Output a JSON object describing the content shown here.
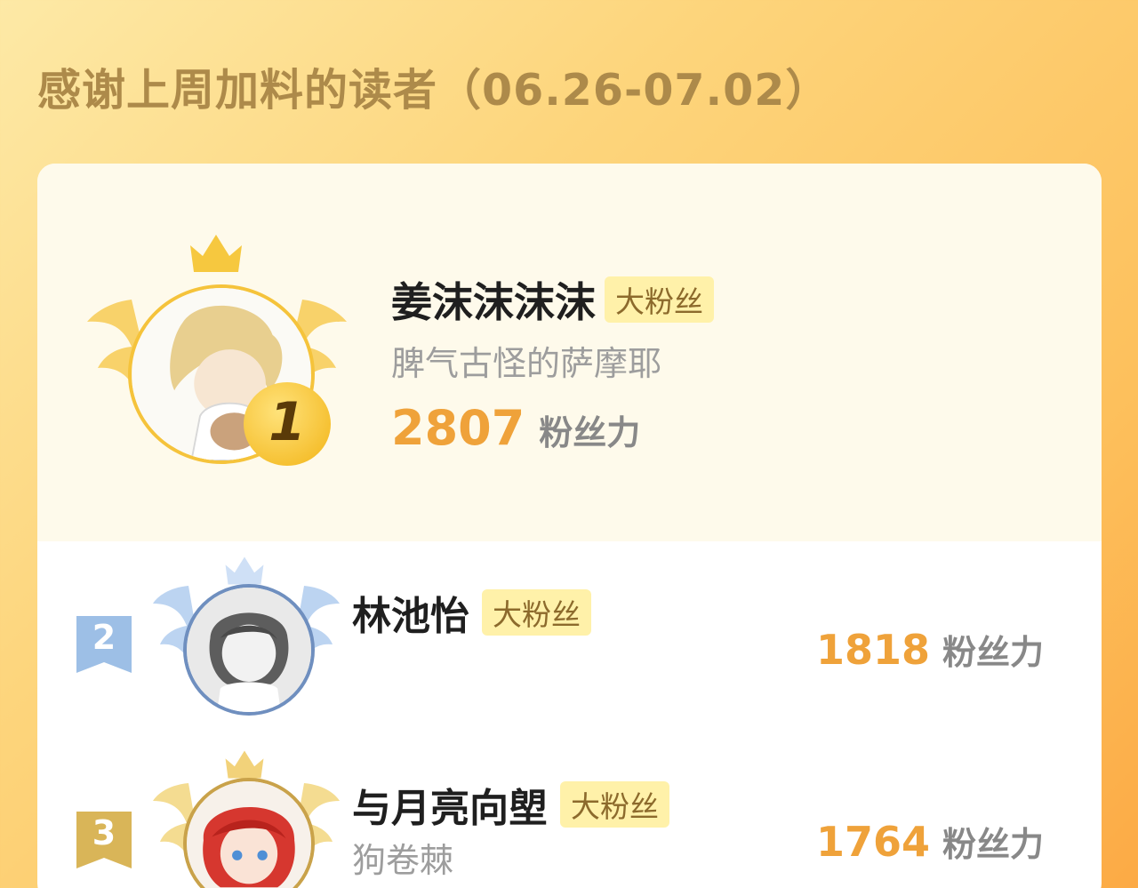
{
  "header": {
    "title": "感谢上周加料的读者（06.26-07.02）"
  },
  "leaderboard": {
    "first": {
      "rank": "1",
      "name": "姜沫沫沫沫",
      "badge": "大粉丝",
      "subtitle": "脾气古怪的萨摩耶",
      "score": "2807",
      "unit": "粉丝力"
    },
    "second": {
      "rank": "2",
      "name": "林池怡",
      "badge": "大粉丝",
      "score": "1818",
      "unit": "粉丝力"
    },
    "third": {
      "rank": "3",
      "name": "与月亮向塱",
      "badge": "大粉丝",
      "subtitle": "狗卷棘",
      "score": "1764",
      "unit": "粉丝力"
    }
  },
  "icons": {
    "crown": "crown-icon",
    "wings": "wings-icon",
    "ribbon": "rank-ribbon-icon"
  },
  "colors": {
    "gold": "#f5c33b",
    "silver": "#8fb1db",
    "bronze": "#d9b558",
    "score": "#efa23a"
  }
}
